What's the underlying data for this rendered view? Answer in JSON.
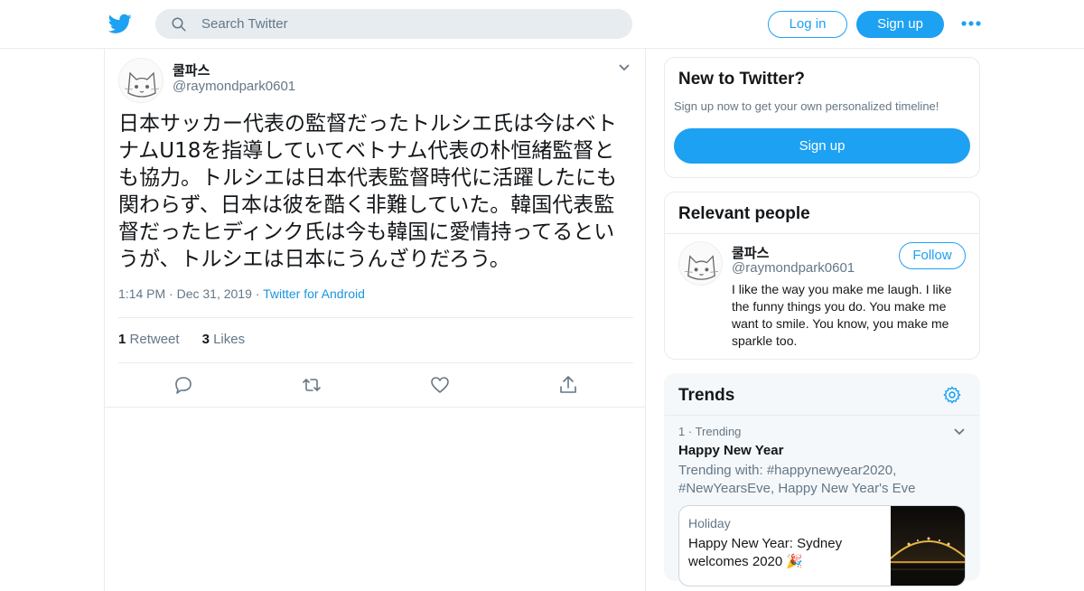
{
  "header": {
    "search_placeholder": "Search Twitter",
    "login_label": "Log in",
    "signup_label": "Sign up",
    "brand_color": "#1da1f2"
  },
  "tweet": {
    "name": "쿨파스",
    "handle": "@raymondpark0601",
    "text": "日本サッカー代表の監督だったトルシエ氏は今はベトナムU18を指導していてベトナム代表の朴恒緒監督とも協力。トルシエは日本代表監督時代に活躍したにも関わらず、日本は彼を酷く非難していた。韓国代表監督だったヒディンク氏は今も韓国に愛情持ってるというが、トルシエは日本にうんざりだろう。",
    "time": "1:14 PM",
    "date": "Dec 31, 2019",
    "source": "Twitter for Android",
    "retweet_count": "1",
    "retweet_label": "Retweet",
    "like_count": "3",
    "like_label": "Likes"
  },
  "new_to_twitter": {
    "title": "New to Twitter?",
    "subtitle": "Sign up now to get your own personalized timeline!",
    "signup_label": "Sign up"
  },
  "relevant_people": {
    "title": "Relevant people",
    "name": "쿨파스",
    "handle": "@raymondpark0601",
    "follow_label": "Follow",
    "bio": "I like the way you make me laugh. I like the funny things you do. You make me want to smile. You know, you make me sparkle too."
  },
  "trends": {
    "title": "Trends",
    "rank": "1",
    "rank_label": "Trending",
    "name": "Happy New Year",
    "trending_with": "Trending with: #happynewyear2020, #NewYearsEve, Happy New Year's Eve",
    "moment_category": "Holiday",
    "moment_title": "Happy New Year: Sydney welcomes 2020 🎉"
  }
}
